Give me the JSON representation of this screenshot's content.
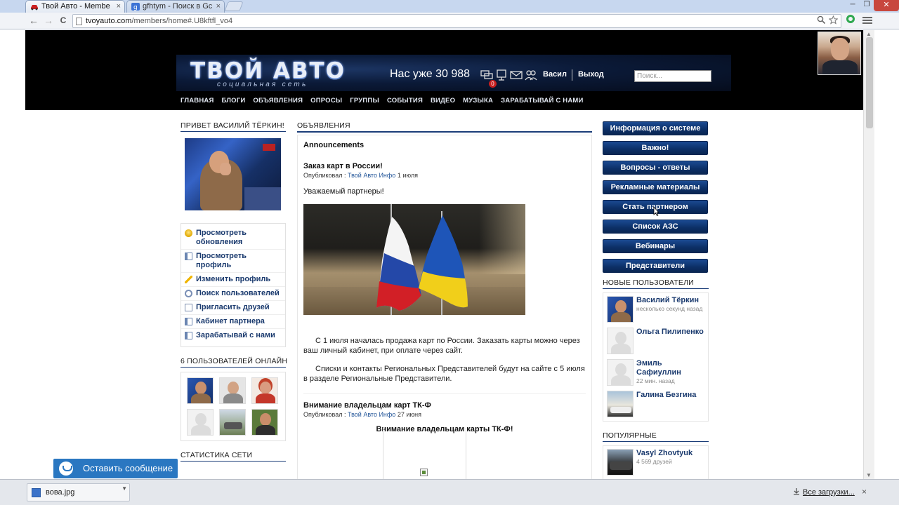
{
  "browser": {
    "tabs": [
      {
        "title": "Твой Авто - Membe",
        "active": true
      },
      {
        "title": "gfhtym - Поиск в Gc",
        "active": false
      }
    ],
    "url_host": "tvoyauto.com",
    "url_path": "/members/home#.U8kftfl_vo4",
    "window_buttons": {
      "minimize": "─",
      "maximize": "❐",
      "close": "✕"
    },
    "back": "←",
    "forward": "→",
    "reload": "C",
    "tab_close": "×"
  },
  "header": {
    "logo_main": "ТВОЙ АВТО",
    "logo_sub": "социальная сеть",
    "member_count": "Нас уже 30 988",
    "notification_count": "0",
    "user_name": "Васил",
    "logout": "Выход",
    "search_placeholder": "Поиск...",
    "nav": [
      "ГЛАВНАЯ",
      "БЛОГИ",
      "ОБЪЯВЛЕНИЯ",
      "ОПРОСЫ",
      "ГРУППЫ",
      "СОБЫТИЯ",
      "ВИДЕО",
      "МУЗЫКА",
      "ЗАРАБАТЫВАЙ С НАМИ"
    ]
  },
  "left": {
    "greeting": "ПРИВЕТ ВАСИЛИЙ ТЁРКИН!",
    "menu": [
      {
        "label": "Просмотреть обновления",
        "icon": "bulb-icon"
      },
      {
        "label": "Просмотреть профиль",
        "icon": "profile-card-icon"
      },
      {
        "label": "Изменить профиль",
        "icon": "pencil-icon"
      },
      {
        "label": "Поиск пользователей",
        "icon": "search-icon"
      },
      {
        "label": "Пригласить друзей",
        "icon": "mail-icon"
      },
      {
        "label": "Кабинет партнера",
        "icon": "profile-card-icon"
      },
      {
        "label": "Зарабатывай с нами",
        "icon": "profile-card-icon"
      }
    ],
    "online_title": "6 ПОЛЬЗОВАТЕЛЕЙ ОНЛАЙН",
    "stats_title": "СТАТИСТИКА СЕТИ"
  },
  "main": {
    "section_title": "ОБЪЯВЛЕНИЯ",
    "announcements_heading": "Announcements",
    "post1": {
      "title": "Заказ карт в России!",
      "meta_prefix": "Опубликовал :",
      "author": "Твой Авто Инфо",
      "date": "1 июля",
      "greeting": "Уважаемый партнеры!",
      "paragraph1": "С 1 июля началась продажа карт по России. Заказать карты можно через ваш личный кабинет, при оплате через сайт.",
      "paragraph2": "Списки и контакты Региональных Представителей будут на сайте с 5 июля в разделе Региональные Представители."
    },
    "post2": {
      "title": "Внимание владельцам карт ТК-Ф",
      "meta_prefix": "Опубликовал :",
      "author": "Твой Авто Инфо",
      "date": "27 июня",
      "headline": "Внимание  владельцам карты ТК-Ф!"
    }
  },
  "right": {
    "buttons": [
      "Информация о системе",
      "Важно!",
      "Вопросы - ответы",
      "Рекламные материалы",
      "Стать партнером",
      "Список АЗС",
      "Вебинары",
      "Представители"
    ],
    "new_users_title": "НОВЫЕ ПОЛЬЗОВАТЕЛИ",
    "new_users": [
      {
        "name": "Василий Тёркин",
        "sub": "несколько секунд назад"
      },
      {
        "name": "Ольга Пилипенко",
        "sub": ""
      },
      {
        "name": "Эмиль Сафиуллин",
        "sub": "22 мин. назад"
      },
      {
        "name": "Галина Безгина",
        "sub": ""
      }
    ],
    "popular_title": "ПОПУЛЯРНЫЕ",
    "popular": [
      {
        "name": "Vasyl Zhovtyuk",
        "sub": "4 569 друзей"
      }
    ]
  },
  "chat": {
    "label": "Оставить сообщение"
  },
  "downloads": {
    "file": "вова.jpg",
    "all_label": "Все загрузки...",
    "close": "×"
  },
  "colors": {
    "nav_button": "#0c2f66",
    "link": "#1a3a6e",
    "chat": "#2a77c1",
    "header_bg": "#000000"
  }
}
